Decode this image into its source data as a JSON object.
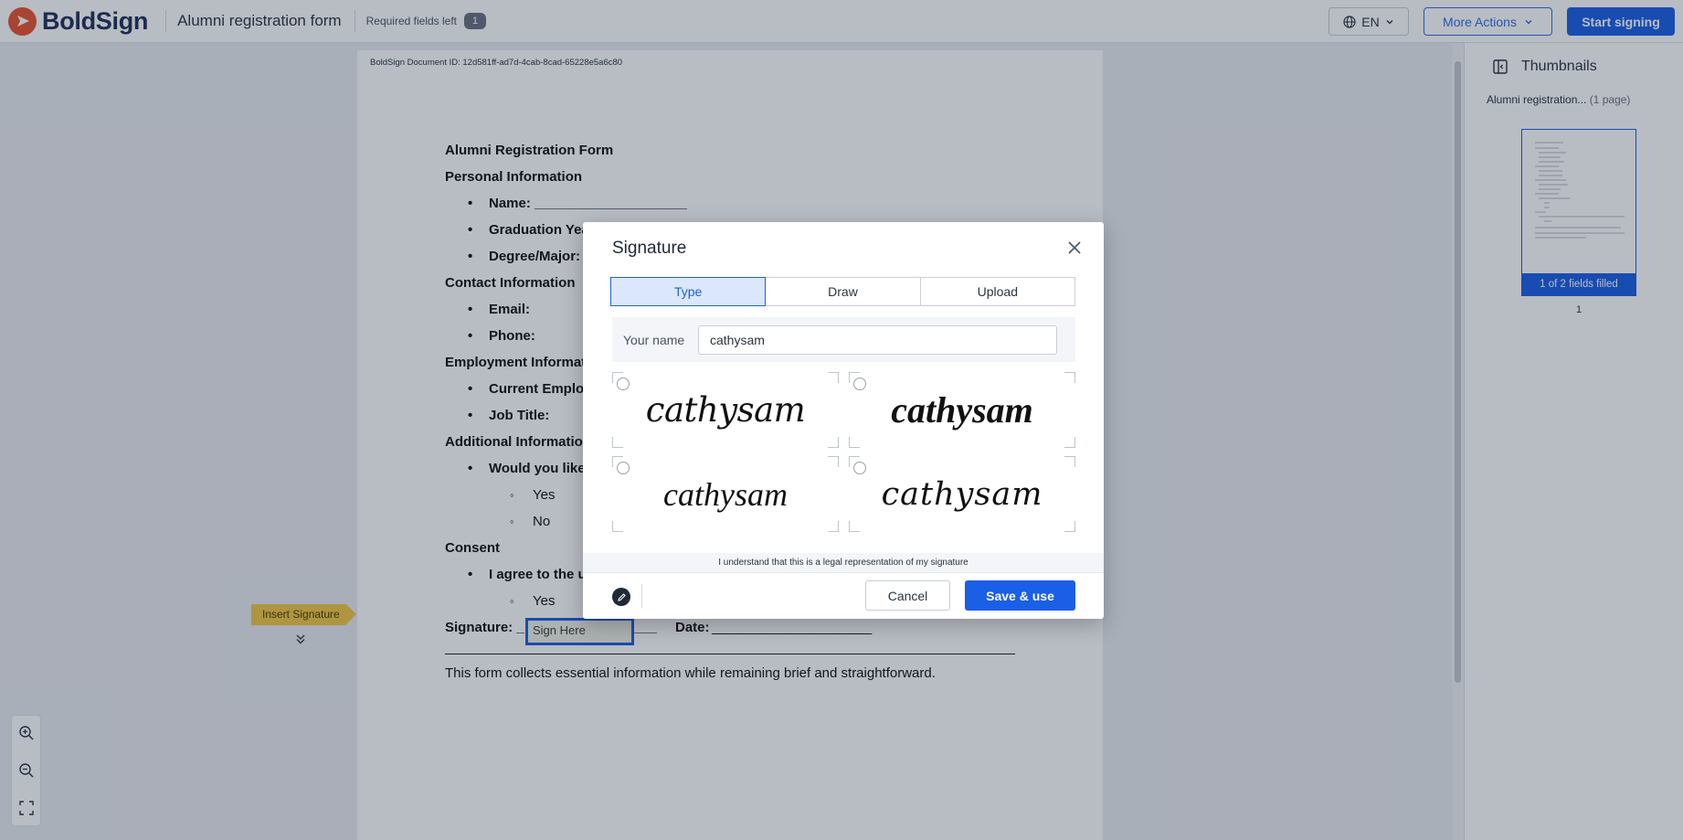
{
  "header": {
    "brand": "BoldSign",
    "doc_title": "Alumni registration form",
    "required_label": "Required fields left",
    "required_count": "1",
    "language": "EN",
    "more_actions": "More Actions",
    "start_signing": "Start signing"
  },
  "document": {
    "doc_id": "BoldSign Document ID: 12d581ff-ad7d-4cab-8cad-65228e5a6c80",
    "title": "Alumni Registration Form",
    "sections": {
      "personal": "Personal Information",
      "name": "Name: ____________________",
      "grad_year": "Graduation Year",
      "degree": "Degree/Major:",
      "contact": "Contact Information",
      "email": "Email:",
      "phone": "Phone:",
      "employment": "Employment Information",
      "employer": "Current Employer",
      "job_title": "Job Title:",
      "additional": "Additional Information",
      "would_like": "Would you like",
      "yes": "Yes",
      "no": "No",
      "consent": "Consent",
      "agree": "I agree to the u",
      "consent_yes": "Yes"
    },
    "signature_label": "Signature: _",
    "sign_here": "Sign Here",
    "date_label": "Date:",
    "footer": "This form collects essential information while remaining brief and straightforward."
  },
  "insert_tag": "Insert Signature",
  "sidebar": {
    "title": "Thumbnails",
    "doc_name": "Alumni registration...",
    "pages": "(1 page)",
    "fields_filled": "1 of 2 fields filled",
    "page_number": "1"
  },
  "modal": {
    "title": "Signature",
    "tabs": [
      "Type",
      "Draw",
      "Upload"
    ],
    "active_tab": "Type",
    "name_label": "Your name",
    "name_value": "cathysam",
    "signature_options": [
      "cathysam",
      "cathysam",
      "cathysam",
      "cathysam"
    ],
    "legal_text": "I understand that this is a legal representation of my signature",
    "cancel": "Cancel",
    "save": "Save & use"
  },
  "colors": {
    "accent": "#1a5fe5",
    "brand_orange": "#e8542f",
    "tag_yellow": "#f2c744"
  }
}
